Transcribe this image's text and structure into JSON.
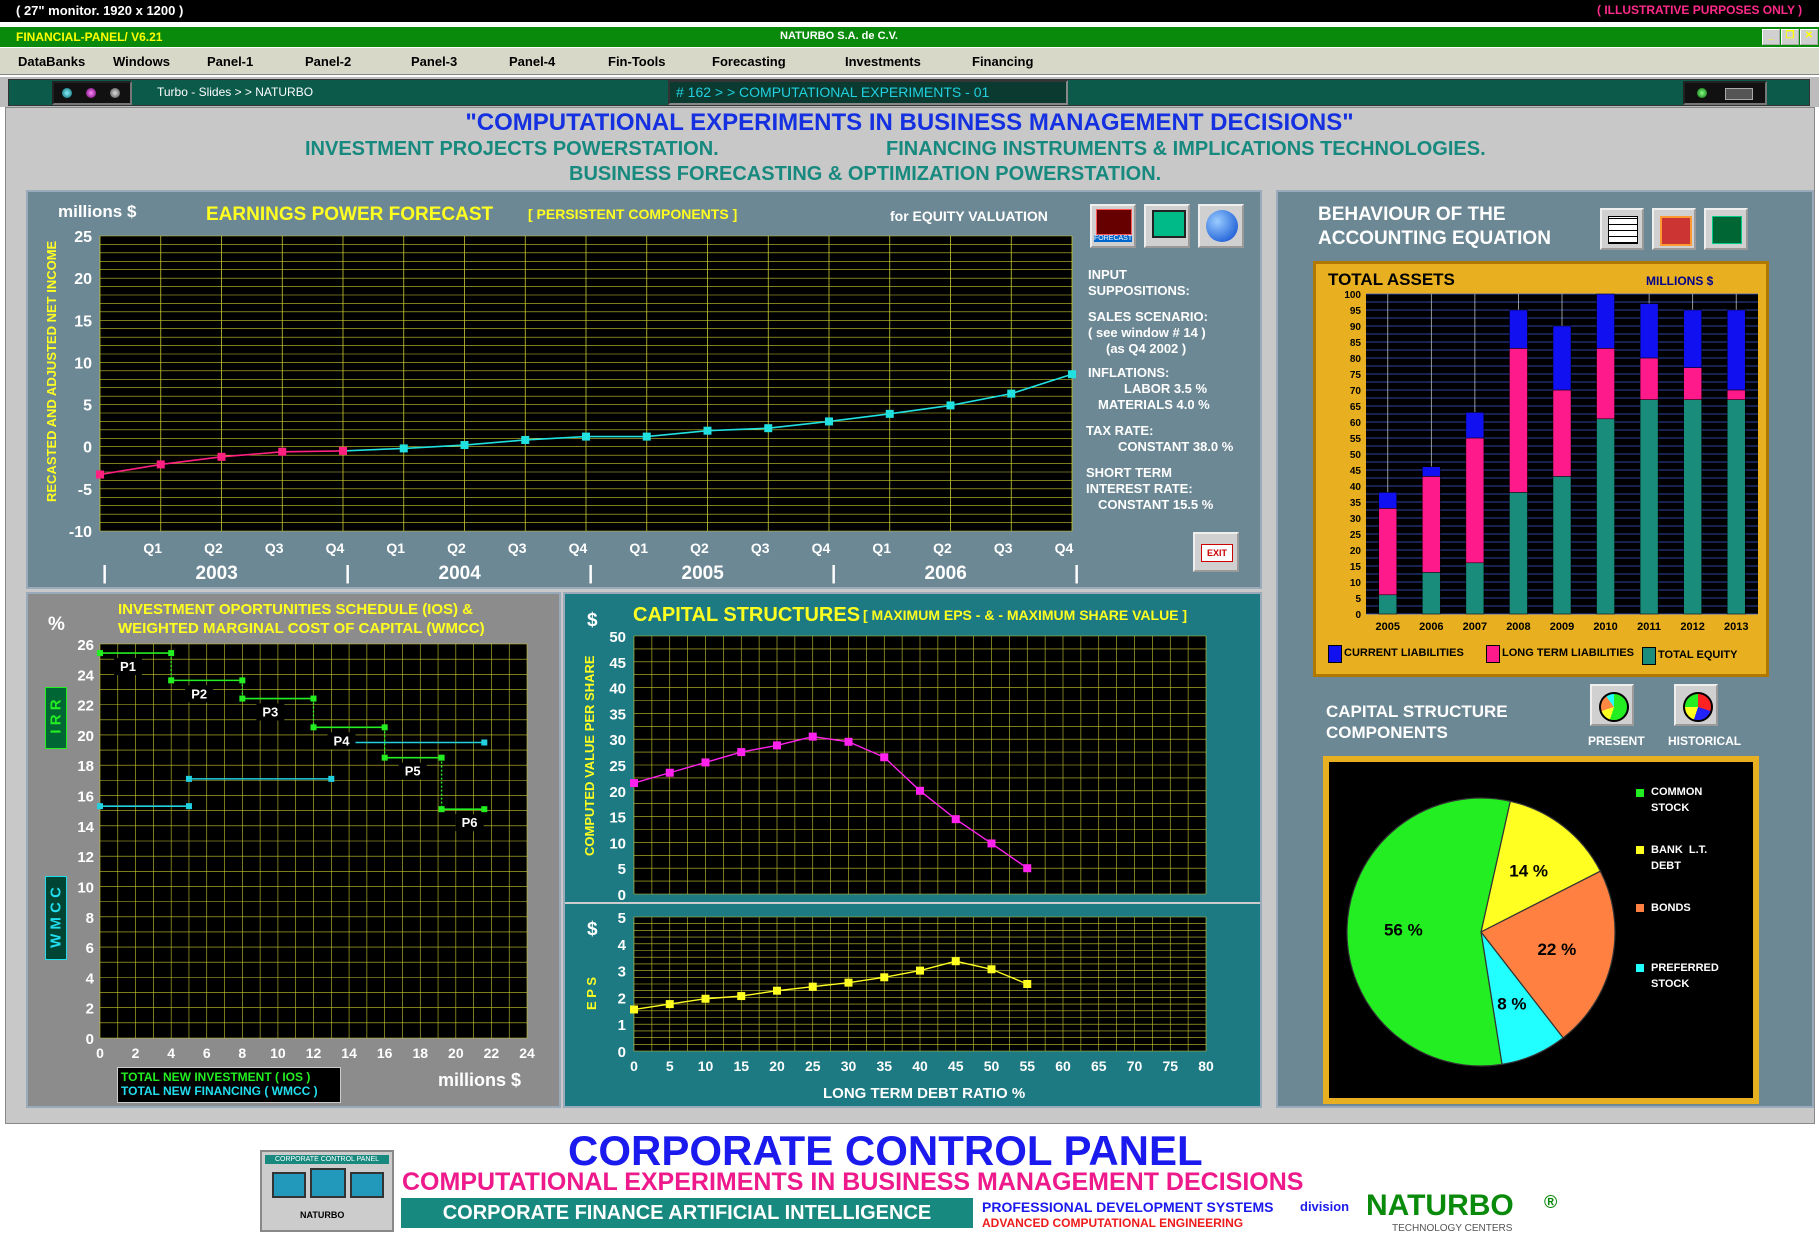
{
  "topbar": {
    "left": "( 27\" monitor.  1920 x 1200 )",
    "right": "( ILLUSTRATIVE  PURPOSES  ONLY )"
  },
  "titlebar": {
    "left": "FINANCIAL-PANEL/ V6.21",
    "center": "NATURBO S.A. de C.V."
  },
  "menu": [
    "DataBanks",
    "Windows",
    "Panel-1",
    "Panel-2",
    "Panel-3",
    "Panel-4",
    "Fin-Tools",
    "Forecasting",
    "Investments",
    "Financing"
  ],
  "toolrow": {
    "breadcrumb": "Turbo - Slides > > NATURBO",
    "slide": "# 162 > > COMPUTATIONAL  EXPERIMENTS - 01"
  },
  "headings": {
    "main": "\"COMPUTATIONAL  EXPERIMENTS  IN  BUSINESS  MANAGEMENT  DECISIONS\"",
    "sub1": "INVESTMENT  PROJECTS  POWERSTATION.",
    "sub2": "FINANCING  INSTRUMENTS  &  IMPLICATIONS  TECHNOLOGIES.",
    "sub3": "BUSINESS  FORECASTING  &  OPTIMIZATION  POWERSTATION."
  },
  "earnings": {
    "unit": "millions  $",
    "title": "EARNINGS  POWER  FORECAST",
    "subtitle": "[ PERSISTENT  COMPONENTS ]",
    "for": "for   EQUITY VALUATION",
    "ylabel": "RECASTED  AND  ADJUSTED  NET  INCOME",
    "quarters": [
      "Q1",
      "Q2",
      "Q3",
      "Q4",
      "Q1",
      "Q2",
      "Q3",
      "Q4",
      "Q1",
      "Q2",
      "Q3",
      "Q4",
      "Q1",
      "Q2",
      "Q3",
      "Q4"
    ],
    "years": [
      "2003",
      "2004",
      "2005",
      "2006"
    ],
    "forecast_btn": "FORECAST",
    "exit": "EXIT",
    "assumptions": {
      "title": "INPUT\nSUPPOSITIONS:",
      "sales": "SALES  SCENARIO:",
      "sales2": "( see window # 14 )",
      "sales3": "(as  Q4 2002 )",
      "infl": "INFLATIONS:",
      "labor": "LABOR  3.5 %",
      "materials": "MATERIALS  4.0 %",
      "tax": "TAX RATE:",
      "tax2": "CONSTANT  38.0 %",
      "short": "SHORT TERM",
      "short2": "INTEREST  RATE:",
      "short3": "CONSTANT  15.5 %"
    }
  },
  "accounting": {
    "title1": "BEHAVIOUR OF THE",
    "title2": "ACCOUNTING EQUATION",
    "chart_title": "TOTAL ASSETS",
    "unit": "MILLIONS $",
    "legend": [
      "CURRENT LIABILITIES",
      "LONG TERM LIABILITIES",
      "TOTAL  EQUITY"
    ]
  },
  "ios": {
    "title1": "INVESTMENT OPORTUNITIES SCHEDULE (IOS)  &",
    "title2": "WEIGHTED MARGINAL COST OF CAPITAL (WMCC)",
    "pct": "%",
    "irr": "I R R",
    "wmcc": "W M C C",
    "labels": [
      "P1",
      "P2",
      "P3",
      "P4",
      "P5",
      "P6"
    ],
    "legend1": "TOTAL NEW INVESTMENT  ( IOS )",
    "legend2": "TOTAL NEW FINANCING ( WMCC )",
    "unit": "millions  $"
  },
  "capital": {
    "title": "CAPITAL  STRUCTURES",
    "subtitle": "[ MAXIMUM  EPS   - & -   MAXIMUM   SHARE  VALUE ]",
    "dollar": "$",
    "ylabel": "COMPUTED VALUE PER SHARE",
    "eps_label": "E P S",
    "xlabel": "LONG TERM DEBT RATIO   %"
  },
  "pie": {
    "title1": "CAPITAL STRUCTURE",
    "title2": "COMPONENTS",
    "present": "PRESENT",
    "historical": "HISTORICAL",
    "legend": [
      "COMMON\nSTOCK",
      "BANK  L.T.\nDEBT",
      "BONDS",
      "PREFERRED\nSTOCK"
    ]
  },
  "footer": {
    "title": "CORPORATE CONTROL PANEL",
    "sub": "COMPUTATIONAL  EXPERIMENTS  IN  BUSINESS  MANAGEMENT  DECISIONS",
    "bar": "CORPORATE  FINANCE  ARTIFICIAL  INTELLIGENCE",
    "pds": "PROFESSIONAL DEVELOPMENT SYSTEMS",
    "division": "division",
    "ace": "ADVANCED COMPUTATIONAL ENGINEERING",
    "brand": "NATURBO",
    "reg": "®",
    "tech": "TECHNOLOGY CENTERS",
    "logo_top": "CORPORATE CONTROL PANEL",
    "logo_bottom": "NATURBO"
  },
  "chart_data": [
    {
      "type": "line",
      "title": "EARNINGS  POWER  FORECAST",
      "ylabel": "RECASTED  AND  ADJUSTED  NET  INCOME",
      "ylim": [
        -10,
        25
      ],
      "yticks": [
        -10,
        -5,
        0,
        5,
        10,
        15,
        20,
        25
      ],
      "x": [
        "Q4 2002",
        "Q1 2003",
        "Q2 2003",
        "Q3 2003",
        "Q4 2003",
        "Q1 2004",
        "Q2 2004",
        "Q3 2004",
        "Q4 2004",
        "Q1 2005",
        "Q2 2005",
        "Q3 2005",
        "Q4 2005",
        "Q1 2006",
        "Q2 2006",
        "Q3 2006",
        "Q4 2006"
      ],
      "values": [
        -3.3,
        -2.1,
        -1.2,
        -0.6,
        -0.5,
        -0.2,
        0.2,
        0.8,
        1.2,
        1.2,
        1.9,
        2.2,
        3.0,
        3.9,
        4.9,
        6.3,
        8.6
      ],
      "colors": [
        "#ff2080",
        "#ff2080",
        "#ff2080",
        "#ff2080",
        "#ff2080",
        "#20e0e0",
        "#20e0e0",
        "#20e0e0",
        "#20e0e0",
        "#20e0e0",
        "#20e0e0",
        "#20e0e0",
        "#20e0e0",
        "#20e0e0",
        "#20e0e0",
        "#20e0e0",
        "#20e0e0"
      ],
      "grid": true
    },
    {
      "type": "bar",
      "title": "TOTAL ASSETS",
      "ylim": [
        0,
        100
      ],
      "yticks": [
        0,
        5,
        10,
        15,
        20,
        25,
        30,
        35,
        40,
        45,
        50,
        55,
        60,
        65,
        70,
        75,
        80,
        85,
        90,
        95,
        100
      ],
      "categories": [
        "2005",
        "2006",
        "2007",
        "2008",
        "2009",
        "2010",
        "2011",
        "2012",
        "2013"
      ],
      "series": [
        {
          "name": "TOTAL  EQUITY",
          "values": [
            6,
            13,
            16,
            38,
            43,
            61,
            67,
            67,
            67
          ],
          "color": "#1a8c7c"
        },
        {
          "name": "LONG TERM LIABILITIES",
          "values": [
            27,
            30,
            39,
            45,
            27,
            22,
            13,
            10,
            3
          ],
          "color": "#ff1a8c"
        },
        {
          "name": "CURRENT LIABILITIES",
          "values": [
            5,
            3,
            8,
            12,
            20,
            17,
            17,
            18,
            25
          ],
          "color": "#1010f0"
        }
      ],
      "grid": true
    },
    {
      "type": "line",
      "title": "INVESTMENT OPORTUNITIES SCHEDULE (IOS)  &  WEIGHTED MARGINAL COST OF CAPITAL (WMCC)",
      "xlabel": "millions  $",
      "xlim": [
        0,
        24
      ],
      "ylim": [
        0,
        26
      ],
      "xticks": [
        0,
        2,
        4,
        6,
        8,
        10,
        12,
        14,
        16,
        18,
        20,
        22,
        24
      ],
      "yticks": [
        0,
        2,
        4,
        6,
        8,
        10,
        12,
        14,
        16,
        18,
        20,
        22,
        24,
        26
      ],
      "series": [
        {
          "name": "TOTAL NEW INVESTMENT  ( IOS )",
          "color": "#22ee22",
          "segments": [
            [
              0,
              4,
              25.4
            ],
            [
              4,
              8,
              23.6
            ],
            [
              8,
              12,
              22.4
            ],
            [
              12,
              16,
              20.5
            ],
            [
              16,
              19.2,
              18.5
            ],
            [
              19.2,
              21.6,
              15.1
            ]
          ]
        },
        {
          "name": "TOTAL NEW FINANCING ( WMCC )",
          "color": "#22d0e0",
          "segments": [
            [
              0,
              5,
              15.3
            ],
            [
              5,
              13,
              17.1
            ],
            [
              13,
              21.6,
              19.5
            ]
          ]
        }
      ]
    },
    {
      "type": "line",
      "ylabel": "COMPUTED VALUE PER SHARE",
      "ylim": [
        0,
        50
      ],
      "xlim": [
        0,
        80
      ],
      "yticks": [
        0,
        5,
        10,
        15,
        20,
        25,
        30,
        35,
        40,
        45,
        50
      ],
      "x": [
        0,
        5,
        10,
        15,
        20,
        25,
        30,
        35,
        40,
        45,
        50,
        55
      ],
      "values": [
        21.5,
        23.5,
        25.5,
        27.5,
        28.8,
        30.5,
        29.5,
        26.5,
        20,
        14.5,
        9.8,
        5
      ],
      "color": "#ff22ee"
    },
    {
      "type": "line",
      "ylabel": "E P S",
      "xlabel": "LONG TERM DEBT RATIO   %",
      "ylim": [
        0,
        5
      ],
      "xlim": [
        0,
        80
      ],
      "yticks": [
        0,
        1,
        2,
        3,
        4,
        5
      ],
      "xticks": [
        0,
        5,
        10,
        15,
        20,
        25,
        30,
        35,
        40,
        45,
        50,
        55,
        60,
        65,
        70,
        75,
        80
      ],
      "x": [
        0,
        5,
        10,
        15,
        20,
        25,
        30,
        35,
        40,
        45,
        50,
        55
      ],
      "values": [
        1.55,
        1.75,
        1.95,
        2.05,
        2.25,
        2.4,
        2.55,
        2.75,
        3.0,
        3.35,
        3.05,
        2.5
      ],
      "color": "#ffff22"
    },
    {
      "type": "pie",
      "title": "CAPITAL STRUCTURE COMPONENTS",
      "slices": [
        {
          "label": "COMMON STOCK",
          "value": 56,
          "color": "#22ee22"
        },
        {
          "label": "BANK  L.T. DEBT",
          "value": 14,
          "color": "#ffff22"
        },
        {
          "label": "BONDS",
          "value": 22,
          "color": "#ff8040"
        },
        {
          "label": "PREFERRED STOCK",
          "value": 8,
          "color": "#22ffff"
        }
      ]
    }
  ]
}
